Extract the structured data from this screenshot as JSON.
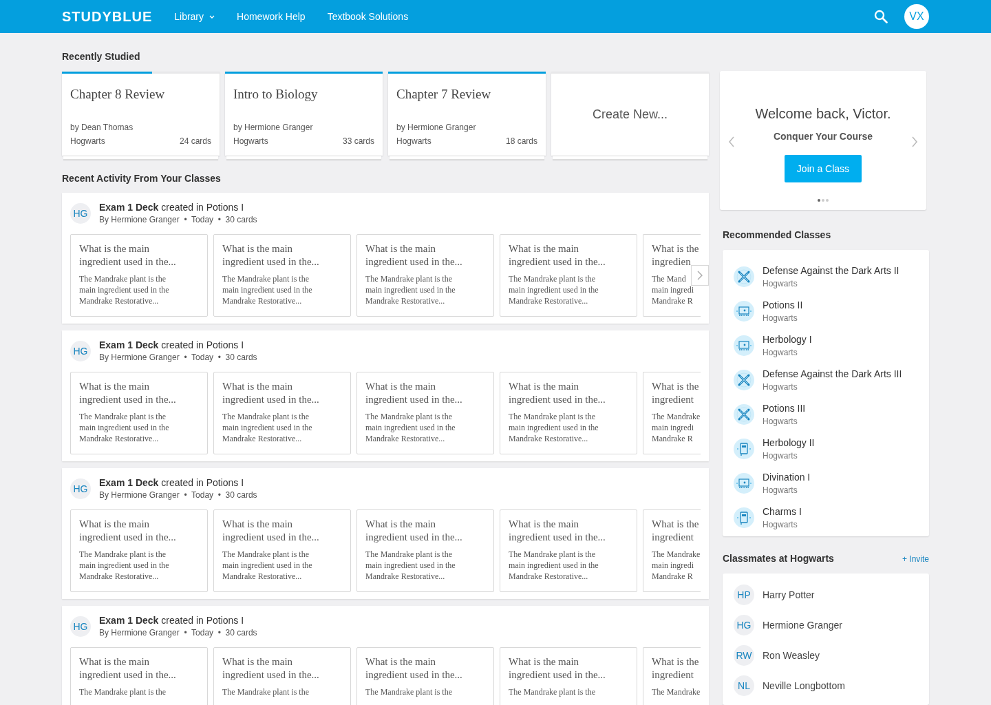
{
  "header": {
    "logo": "STUDYBLUE",
    "nav": [
      {
        "label": "Library",
        "dropdown": true
      },
      {
        "label": "Homework Help",
        "dropdown": false
      },
      {
        "label": "Textbook Solutions",
        "dropdown": false
      }
    ],
    "avatar": "VX"
  },
  "recently_studied": {
    "title": "Recently Studied",
    "decks": [
      {
        "kind": "deck",
        "title": "Chapter 8 Review",
        "author": "by Dean Thomas",
        "school": "Hogwarts",
        "count": "24 cards",
        "level": 0.57
      },
      {
        "kind": "deck",
        "title": "Intro to Biology",
        "author": "by Hermione Granger",
        "school": "Hogwarts",
        "count": "33 cards",
        "level": 1
      },
      {
        "kind": "deck",
        "title": "Chapter 7 Review",
        "author": "by Hermione Granger",
        "school": "Hogwarts",
        "count": "18 cards",
        "level": 1
      },
      {
        "kind": "create",
        "title": "Create New..."
      }
    ]
  },
  "recent_activity": {
    "title": "Recent Activity From Your Classes",
    "items": [
      {
        "initials": "HG",
        "title": "**Exam 1 Deck** created in Potions I",
        "meta": "By Hermione Granger  •  Today  •  30 cards",
        "scroll_arrow": true,
        "cards": [
          {
            "kind": "full",
            "question": "What is the main ingredient used in the...",
            "answer": "The Mandrake plant is the main ingredient used in the Mandrake Restorative..."
          },
          {
            "kind": "full",
            "question": "What is the main ingredient used in the...",
            "answer": "The Mandrake plant is the main ingredient used in the Mandrake Restorative..."
          },
          {
            "kind": "full",
            "question": "What is the main ingredient used in the...",
            "answer": "The Mandrake plant is the main ingredient used in the Mandrake Restorative..."
          },
          {
            "kind": "full",
            "question": "What is the main ingredient used in the...",
            "answer": "The Mandrake plant is the main ingredient used in the Mandrake Restorative..."
          },
          {
            "kind": "clipped",
            "question_lines": [
              "What is the",
              "ingredien"
            ],
            "answer_lines": [
              "The Mand",
              "main ingredi",
              "Mandrake R"
            ]
          }
        ]
      },
      {
        "initials": "HG",
        "title": "**Exam 1 Deck** created in Potions I",
        "meta": "By Hermione Granger  •  Today  •  30 cards",
        "scroll_arrow": false,
        "cards": [
          {
            "kind": "full",
            "question": "What is the main ingredient used in the...",
            "answer": "The Mandrake plant is the main ingredient used in the Mandrake Restorative..."
          },
          {
            "kind": "full",
            "question": "What is the main ingredient used in the...",
            "answer": "The Mandrake plant is the main ingredient used in the Mandrake Restorative..."
          },
          {
            "kind": "full",
            "question": "What is the main ingredient used in the...",
            "answer": "The Mandrake plant is the main ingredient used in the Mandrake Restorative..."
          },
          {
            "kind": "full",
            "question": "What is the main ingredient used in the...",
            "answer": "The Mandrake plant is the main ingredient used in the Mandrake Restorative..."
          },
          {
            "kind": "clipped",
            "question_lines": [
              "What is the",
              "ingredient"
            ],
            "answer_lines": [
              "The Mandrake",
              "main ingredi",
              "Mandrake R"
            ]
          }
        ]
      },
      {
        "initials": "HG",
        "title": "**Exam 1 Deck** created in Potions I",
        "meta": "By Hermione Granger  •  Today  •  30 cards",
        "scroll_arrow": false,
        "cards": [
          {
            "kind": "full",
            "question": "What is the main ingredient used in the...",
            "answer": "The Mandrake plant is the main ingredient used in the Mandrake Restorative..."
          },
          {
            "kind": "full",
            "question": "What is the main ingredient used in the...",
            "answer": "The Mandrake plant is the main ingredient used in the Mandrake Restorative..."
          },
          {
            "kind": "full",
            "question": "What is the main ingredient used in the...",
            "answer": "The Mandrake plant is the main ingredient used in the Mandrake Restorative..."
          },
          {
            "kind": "full",
            "question": "What is the main ingredient used in the...",
            "answer": "The Mandrake plant is the main ingredient used in the Mandrake Restorative..."
          },
          {
            "kind": "clipped",
            "question_lines": [
              "What is the",
              "ingredient"
            ],
            "answer_lines": [
              "The Mandrake",
              "main ingredi",
              "Mandrake R"
            ]
          }
        ]
      },
      {
        "initials": "HG",
        "title": "**Exam 1 Deck** created in Potions I",
        "meta": "By Hermione Granger  •  Today  •  30 cards",
        "scroll_arrow": false,
        "cards": [
          {
            "kind": "full",
            "question": "What is the main ingredient used in the...",
            "answer": "The Mandrake plant is the"
          },
          {
            "kind": "full",
            "question": "What is the main ingredient used in the...",
            "answer": "The Mandrake plant is the"
          },
          {
            "kind": "full",
            "question": "What is the main ingredient used in the...",
            "answer": "The Mandrake plant is the"
          },
          {
            "kind": "full",
            "question": "What is the main ingredient used in the...",
            "answer": "The Mandrake plant is the"
          },
          {
            "kind": "clipped",
            "question_lines": [
              "What is the",
              "ingredient"
            ],
            "answer_lines": [
              "The Mandrake"
            ]
          }
        ]
      }
    ]
  },
  "welcome": {
    "heading": "Welcome back, Victor.",
    "subheading": "Conquer Your Course",
    "button": "Join a Class",
    "dots": [
      {
        "selected": true
      },
      {
        "selected": false
      },
      {
        "selected": false
      }
    ]
  },
  "recommended": {
    "title": "Recommended Classes",
    "classes": [
      {
        "name": "Defense Against the Dark Arts II",
        "school": "Hogwarts",
        "kind": "pencils"
      },
      {
        "name": "Potions II",
        "school": "Hogwarts",
        "kind": "board"
      },
      {
        "name": "Herbology I",
        "school": "Hogwarts",
        "kind": "board"
      },
      {
        "name": "Defense Against the Dark Arts III",
        "school": "Hogwarts",
        "kind": "pencils"
      },
      {
        "name": "Potions III",
        "school": "Hogwarts",
        "kind": "pencils"
      },
      {
        "name": "Herbology II",
        "school": "Hogwarts",
        "kind": "book"
      },
      {
        "name": "Divination I",
        "school": "Hogwarts",
        "kind": "board"
      },
      {
        "name": "Charms I",
        "school": "Hogwarts",
        "kind": "book"
      }
    ]
  },
  "classmates": {
    "title": "Classmates at Hogwarts",
    "invite": "+ Invite",
    "people": [
      {
        "initials": "HP",
        "name": "Harry Potter"
      },
      {
        "initials": "HG",
        "name": "Hermione Granger"
      },
      {
        "initials": "RW",
        "name": "Ron Weasley"
      },
      {
        "initials": "NL",
        "name": "Neville Longbottom"
      }
    ]
  }
}
